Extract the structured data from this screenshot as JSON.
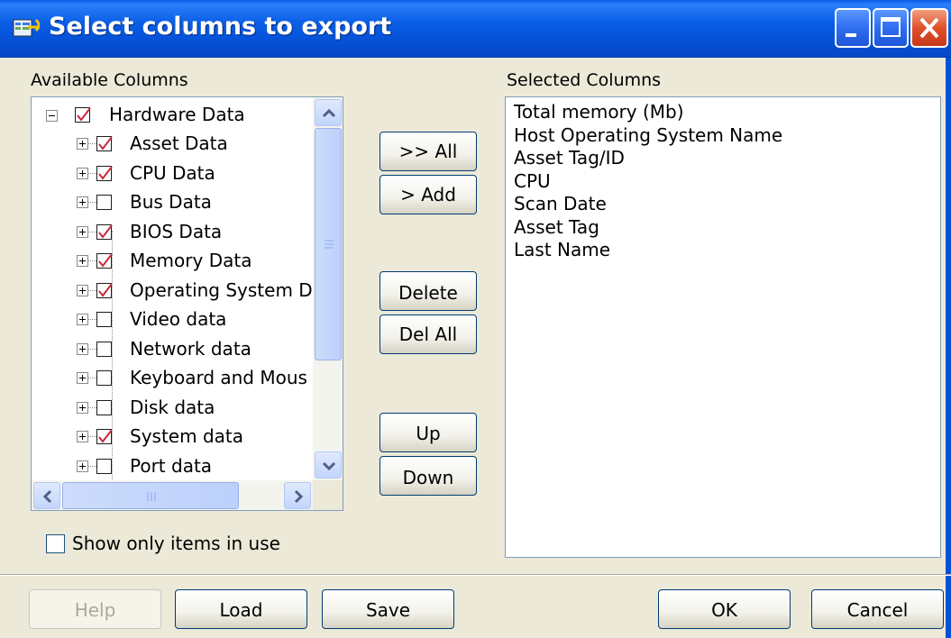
{
  "window": {
    "title": "Select columns to export",
    "controls": {
      "minimize": "minimize-icon",
      "maximize": "maximize-icon",
      "close": "close-icon"
    }
  },
  "available": {
    "label": "Available Columns",
    "root": {
      "label": "Hardware Data",
      "checked": true,
      "expanded": true
    },
    "items": [
      {
        "label": "Asset Data",
        "checked": true
      },
      {
        "label": "CPU Data",
        "checked": true
      },
      {
        "label": "Bus Data",
        "checked": false
      },
      {
        "label": "BIOS Data",
        "checked": true
      },
      {
        "label": "Memory Data",
        "checked": true
      },
      {
        "label": "Operating System D",
        "checked": true
      },
      {
        "label": "Video data",
        "checked": false
      },
      {
        "label": "Network data",
        "checked": false
      },
      {
        "label": "Keyboard and Mous",
        "checked": false
      },
      {
        "label": "Disk data",
        "checked": false
      },
      {
        "label": "System data",
        "checked": true
      },
      {
        "label": "Port data",
        "checked": false
      }
    ]
  },
  "buttons": {
    "all": ">> All",
    "add": "> Add",
    "delete": "Delete",
    "del_all": "Del All",
    "up": "Up",
    "down": "Down"
  },
  "show_only": {
    "label": "Show only items in use",
    "checked": false
  },
  "selected": {
    "label": "Selected Columns",
    "items": [
      "Total memory (Mb)",
      "Host Operating System Name",
      "Asset Tag/ID",
      "CPU",
      "Scan Date",
      "Asset Tag",
      "Last Name"
    ]
  },
  "footer": {
    "help": "Help",
    "load": "Load",
    "save": "Save",
    "ok": "OK",
    "cancel": "Cancel"
  },
  "colors": {
    "title_bar": "#0a5ee6",
    "check_mark": "#c8283c",
    "dialog_bg": "#ece9d8",
    "button_border": "#003c74"
  }
}
